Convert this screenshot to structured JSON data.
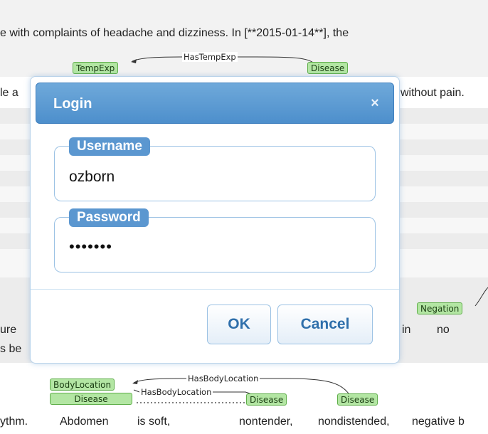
{
  "background": {
    "line1": "e with complaints of headache and dizziness.  In [**2015-01-14**], the",
    "line2_left": "le a",
    "line2_right": "without pain.",
    "line5_left1": "ure",
    "line5_left2": "s be",
    "line5_in": "in",
    "line5_no": "no",
    "bottom_line": {
      "rhythm": "ythm.",
      "abdomen": "Abdomen",
      "is_soft": "is soft,",
      "nontender": "nontender,",
      "nondistended": "nondistended,",
      "negative": "negative b"
    },
    "tags": {
      "tempexp": "TempExp",
      "disease_top": "Disease",
      "negation": "Negation",
      "bodylocation": "BodyLocation",
      "disease_b1": "Disease",
      "disease_b2": "Disease",
      "disease_b3": "Disease"
    },
    "relations": {
      "hastempexp": "HasTempExp",
      "hasbodylocation1": "HasBodyLocation",
      "hasbodylocation2": "HasBodyLocation"
    }
  },
  "modal": {
    "title": "Login",
    "close_glyph": "×",
    "username": {
      "legend": "Username",
      "value": "ozborn"
    },
    "password": {
      "legend": "Password",
      "value": "•••••••"
    },
    "ok_label": "OK",
    "cancel_label": "Cancel"
  },
  "colors": {
    "header": "#5b97d0",
    "button_text": "#2f6fab",
    "tag_fill": "#b3e6a3"
  }
}
